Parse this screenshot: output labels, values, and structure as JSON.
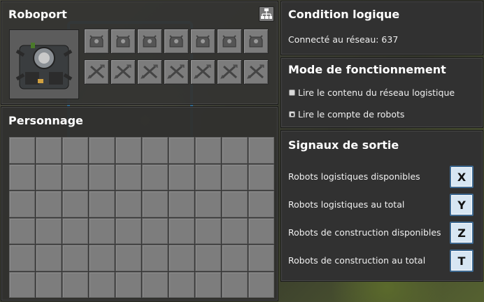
{
  "roboport": {
    "title": "Roboport",
    "network_icon": "logistic-network-icon",
    "robot_slots": [
      "logistic-robot-slot-icon",
      "logistic-robot-slot-icon",
      "logistic-robot-slot-icon",
      "logistic-robot-slot-icon",
      "logistic-robot-slot-icon",
      "logistic-robot-slot-icon",
      "logistic-robot-slot-icon"
    ],
    "repair_slots": [
      "repair-pack-slot-icon",
      "repair-pack-slot-icon",
      "repair-pack-slot-icon",
      "repair-pack-slot-icon",
      "repair-pack-slot-icon",
      "repair-pack-slot-icon",
      "repair-pack-slot-icon"
    ]
  },
  "personnage": {
    "title": "Personnage",
    "inventory_columns": 10,
    "inventory_rows": 6
  },
  "condition": {
    "title": "Condition logique",
    "connected_text": "Connecté au réseau: 637"
  },
  "mode": {
    "title": "Mode de fonctionnement",
    "options": [
      {
        "label": "Lire le contenu du réseau logistique",
        "selected": false
      },
      {
        "label": "Lire le compte de robots",
        "selected": true
      }
    ]
  },
  "signaux": {
    "title": "Signaux de sortie",
    "rows": [
      {
        "label": "Robots logistiques disponibles",
        "signal": "X"
      },
      {
        "label": "Robots logistiques au total",
        "signal": "Y"
      },
      {
        "label": "Robots de construction disponibles",
        "signal": "Z"
      },
      {
        "label": "Robots de construction au total",
        "signal": "T"
      }
    ]
  },
  "colors": {
    "panel_bg": "#313131",
    "slot_bg": "#7c7c7c",
    "signal_button_bg": "#d7e6f3",
    "signal_button_border": "#3f6b94"
  }
}
